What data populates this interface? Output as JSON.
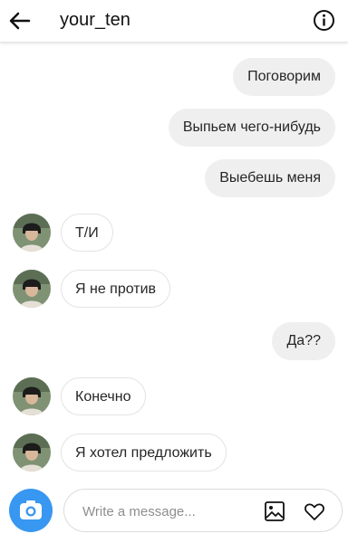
{
  "header": {
    "username": "your_ten"
  },
  "messages": {
    "m1": "Поговорим",
    "m2": "Выпьем чего-нибудь",
    "m3": "Выебешь меня",
    "m4": "Т/И",
    "m5": "Я не против",
    "m6": "Да??",
    "m7": "Конечно",
    "m8": "Я хотел предложить"
  },
  "composer": {
    "placeholder": "Write a message..."
  },
  "icons": {
    "back": "arrow-left-icon",
    "info": "info-icon",
    "camera": "camera-icon",
    "gallery": "gallery-icon",
    "heart": "heart-icon"
  },
  "colors": {
    "accent": "#3897f0",
    "outgoing_bubble": "#efefef",
    "incoming_border": "#e3e3e3"
  }
}
